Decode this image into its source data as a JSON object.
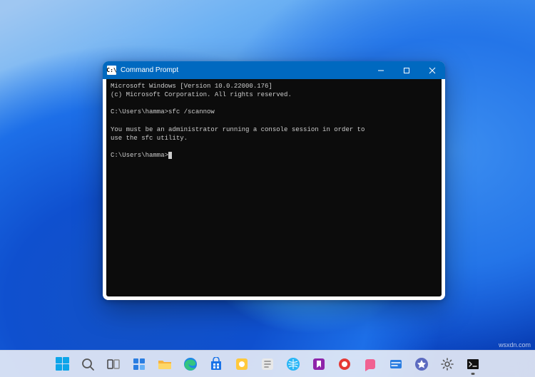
{
  "window": {
    "title": "Command Prompt",
    "sys_icon_text": "C:\\"
  },
  "terminal": {
    "line1": "Microsoft Windows [Version 10.0.22000.176]",
    "line2": "(c) Microsoft Corporation. All rights reserved.",
    "prompt1": "C:\\Users\\hamma>",
    "cmd1": "sfc /scannow",
    "msg1": "You must be an administrator running a console session in order to",
    "msg2": "use the sfc utility.",
    "prompt2": "C:\\Users\\hamma>"
  },
  "taskbar": {
    "items": [
      {
        "name": "start-button"
      },
      {
        "name": "search-button"
      },
      {
        "name": "task-view-button"
      },
      {
        "name": "widgets-button"
      },
      {
        "name": "file-explorer-button"
      },
      {
        "name": "edge-button"
      },
      {
        "name": "store-button"
      },
      {
        "name": "app-button-1"
      },
      {
        "name": "app-button-2"
      },
      {
        "name": "app-button-3"
      },
      {
        "name": "app-button-4"
      },
      {
        "name": "app-button-5"
      },
      {
        "name": "app-button-6"
      },
      {
        "name": "app-button-7"
      },
      {
        "name": "app-button-8"
      },
      {
        "name": "settings-button"
      },
      {
        "name": "command-prompt-button"
      }
    ]
  },
  "watermark": "wsxdn.com"
}
